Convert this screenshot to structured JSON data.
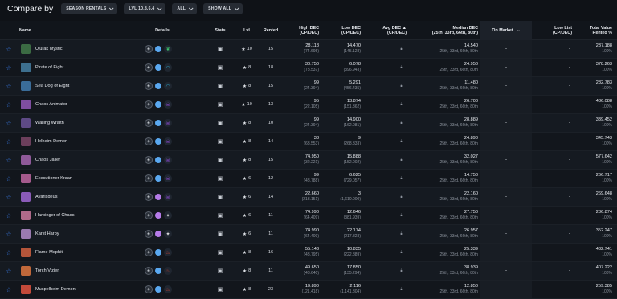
{
  "toolbar": {
    "title": "Compare by",
    "filters": [
      "SEASON RENTALS",
      "LVL 10,8,6,4",
      "ALL",
      "SHOW ALL"
    ]
  },
  "columns": {
    "name": "Name",
    "details": "Details",
    "stats": "Stats",
    "lvl": "Lvl",
    "rented": "Rented",
    "high": "High DEC",
    "high_sub": "(CP/DEC)",
    "low": "Low DEC",
    "low_sub": "(CP/DEC)",
    "avg": "Avg DEC ▲",
    "avg_sub": "(CP/DEC)",
    "median": "Median DEC",
    "median_sub": "(25th, 33rd, 66th, 80th)",
    "on_market": "On Market",
    "low_list": "Low List",
    "low_list_sub": "(CP/DEC)",
    "total": "Total Value",
    "total_sub": "Rented %"
  },
  "colors": {
    "accent": "#3b82f6",
    "edition_blue": "#5aa8f0",
    "edition_purple": "#b57be8",
    "earth": "#3cc36a",
    "water": "#27b1d6",
    "death": "#9a4ee6",
    "fire": "#e0452f",
    "neutral": "#e5e5e5"
  },
  "rows": [
    {
      "name": "Ujurak Mystic",
      "element_icon": "leaf-icon",
      "edition": "blue",
      "lvl": "10",
      "rented": "15",
      "high": "28.118",
      "high_cp": "(74.695)",
      "low": "14.470",
      "low_cp": "(145.128)",
      "median": "14.540",
      "quart": "25th, 33rd, 66th, 80th",
      "market": "-",
      "low_list": "-",
      "total": "237.188",
      "pct": "100%",
      "thumb": "#3b6b43"
    },
    {
      "name": "Pirate of Eight",
      "element_icon": "wave-icon",
      "edition": "blue",
      "lvl": "8",
      "rented": "18",
      "high": "30.750",
      "high_cp": "(78.537)",
      "low": "6.078",
      "low_cp": "(396.943)",
      "median": "24.950",
      "quart": "25th, 33rd, 66th, 80th",
      "market": "-",
      "low_list": "-",
      "total": "378.263",
      "pct": "100%",
      "thumb": "#3d6f8e"
    },
    {
      "name": "Sea Dog of Eight",
      "element_icon": "wave-icon",
      "edition": "blue",
      "lvl": "8",
      "rented": "15",
      "high": "99",
      "high_cp": "(24.394)",
      "low": "5.291",
      "low_cp": "(456.435)",
      "median": "11.480",
      "quart": "25th, 33rd, 66th, 80th",
      "market": "-",
      "low_list": "-",
      "total": "282.783",
      "pct": "100%",
      "thumb": "#3a6c98"
    },
    {
      "name": "Chaos Animator",
      "element_icon": "skull-icon",
      "edition": "blue",
      "lvl": "10",
      "rented": "13",
      "high": "95",
      "high_cp": "(22.105)",
      "low": "13.874",
      "low_cp": "(151.362)",
      "median": "26.700",
      "quart": "25th, 33rd, 66th, 80th",
      "market": "-",
      "low_list": "-",
      "total": "486.088",
      "pct": "100%",
      "thumb": "#7f4ea0"
    },
    {
      "name": "Wailing Wraith",
      "element_icon": "skull-icon",
      "edition": "blue",
      "lvl": "8",
      "rented": "10",
      "high": "99",
      "high_cp": "(24.394)",
      "low": "14.900",
      "low_cp": "(162.081)",
      "median": "28.889",
      "quart": "25th, 33rd, 66th, 80th",
      "market": "-",
      "low_list": "-",
      "total": "339.452",
      "pct": "100%",
      "thumb": "#5e4a86"
    },
    {
      "name": "Helheim Demon",
      "element_icon": "skull-icon",
      "edition": "blue",
      "lvl": "8",
      "rented": "14",
      "high": "38",
      "high_cp": "(63.553)",
      "low": "9",
      "low_cp": "(268.333)",
      "median": "24.890",
      "quart": "25th, 33rd, 66th, 80th",
      "market": "-",
      "low_list": "-",
      "total": "345.743",
      "pct": "100%",
      "thumb": "#6c3f5c"
    },
    {
      "name": "Chaos Jailer",
      "element_icon": "skull-icon",
      "edition": "blue",
      "lvl": "8",
      "rented": "15",
      "high": "74.950",
      "high_cp": "(32.221)",
      "low": "15.888",
      "low_cp": "(152.002)",
      "median": "32.027",
      "quart": "25th, 33rd, 66th, 80th",
      "market": "-",
      "low_list": "-",
      "total": "577.642",
      "pct": "100%",
      "thumb": "#8f5a9a"
    },
    {
      "name": "Executioner Kraan",
      "element_icon": "skull-icon",
      "edition": "blue",
      "lvl": "6",
      "rented": "12",
      "high": "99",
      "high_cp": "(48.788)",
      "low": "6.625",
      "low_cp": "(729.057)",
      "median": "14.750",
      "quart": "25th, 33rd, 66th, 80th",
      "market": "-",
      "low_list": "-",
      "total": "266.717",
      "pct": "100%",
      "thumb": "#a45a8c"
    },
    {
      "name": "Avarisdeus",
      "element_icon": "skull-icon",
      "edition": "purple",
      "lvl": "6",
      "rented": "14",
      "high": "22.660",
      "high_cp": "(213.151)",
      "low": "3",
      "low_cp": "(1,610.000)",
      "median": "22.160",
      "quart": "25th, 33rd, 66th, 80th",
      "market": "-",
      "low_list": "-",
      "total": "269.648",
      "pct": "100%",
      "thumb": "#8a5bb8"
    },
    {
      "name": "Harbinger of Chaos",
      "element_icon": "sparkle-icon",
      "edition": "purple",
      "lvl": "6",
      "rented": "11",
      "high": "74.990",
      "high_cp": "(64.409)",
      "low": "12.646",
      "low_cp": "(381.939)",
      "median": "27.750",
      "quart": "25th, 33rd, 66th, 80th",
      "market": "-",
      "low_list": "-",
      "total": "286.874",
      "pct": "100%",
      "thumb": "#b06a8a"
    },
    {
      "name": "Karst Harpy",
      "element_icon": "sparkle-icon",
      "edition": "purple",
      "lvl": "6",
      "rented": "11",
      "high": "74.990",
      "high_cp": "(64.409)",
      "low": "22.174",
      "low_cp": "(217.823)",
      "median": "26.957",
      "quart": "25th, 33rd, 66th, 80th",
      "market": "-",
      "low_list": "-",
      "total": "352.247",
      "pct": "100%",
      "thumb": "#9a7ab0"
    },
    {
      "name": "Flame Mephit",
      "element_icon": "fire-icon",
      "edition": "blue",
      "lvl": "8",
      "rented": "16",
      "high": "55.143",
      "high_cp": "(43.795)",
      "low": "10.835",
      "low_cp": "(222.889)",
      "median": "25.339",
      "quart": "25th, 33rd, 66th, 80th",
      "market": "-",
      "low_list": "-",
      "total": "432.741",
      "pct": "100%",
      "thumb": "#b4553a"
    },
    {
      "name": "Torch Vizier",
      "element_icon": "fire-icon",
      "edition": "blue",
      "lvl": "8",
      "rented": "11",
      "high": "49.650",
      "high_cp": "(48.640)",
      "low": "17.850",
      "low_cp": "(135.294)",
      "median": "38.939",
      "quart": "25th, 33rd, 66th, 80th",
      "market": "-",
      "low_list": "-",
      "total": "407.222",
      "pct": "100%",
      "thumb": "#c0683a"
    },
    {
      "name": "Muspelheim Demon",
      "element_icon": "fire-icon",
      "edition": "blue",
      "lvl": "8",
      "rented": "23",
      "high": "19.890",
      "high_cp": "(121.418)",
      "low": "2.116",
      "low_cp": "(1,141.304)",
      "median": "12.850",
      "quart": "25th, 33rd, 66th, 80th",
      "market": "-",
      "low_list": "-",
      "total": "259.385",
      "pct": "100%",
      "thumb": "#c24a3a"
    }
  ]
}
